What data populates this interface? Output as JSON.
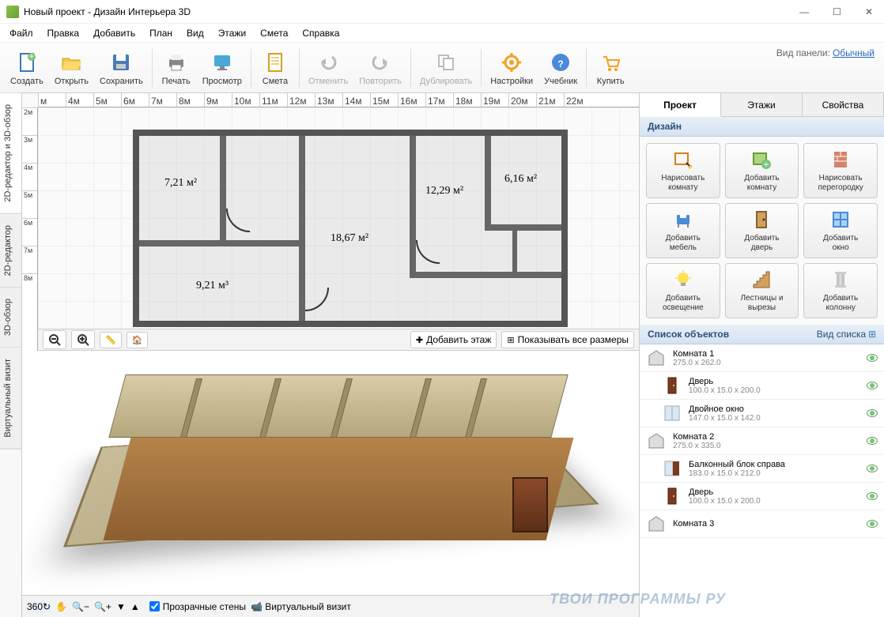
{
  "window": {
    "title": "Новый проект - Дизайн Интерьера 3D"
  },
  "menu": [
    "Файл",
    "Правка",
    "Добавить",
    "План",
    "Вид",
    "Этажи",
    "Смета",
    "Справка"
  ],
  "toolbar": [
    {
      "label": "Создать",
      "icon": "file-new"
    },
    {
      "label": "Открыть",
      "icon": "folder-open"
    },
    {
      "label": "Сохранить",
      "icon": "save"
    },
    {
      "sep": true
    },
    {
      "label": "Печать",
      "icon": "printer"
    },
    {
      "label": "Просмотр",
      "icon": "monitor"
    },
    {
      "sep": true
    },
    {
      "label": "Смета",
      "icon": "estimate"
    },
    {
      "sep": true
    },
    {
      "label": "Отменить",
      "icon": "undo",
      "disabled": true
    },
    {
      "label": "Повторить",
      "icon": "redo",
      "disabled": true
    },
    {
      "sep": true
    },
    {
      "label": "Дублировать",
      "icon": "duplicate",
      "disabled": true
    },
    {
      "sep": true
    },
    {
      "label": "Настройки",
      "icon": "gear"
    },
    {
      "label": "Учебник",
      "icon": "help"
    },
    {
      "sep": true
    },
    {
      "label": "Купить",
      "icon": "cart"
    }
  ],
  "panel_label": {
    "prefix": "Вид панели:",
    "link": "Обычный"
  },
  "left_tabs": [
    "2D-редактор и 3D-обзор",
    "2D-редактор",
    "3D-обзор",
    "Виртуальный визит"
  ],
  "ruler_h": [
    "м",
    "4м",
    "5м",
    "6м",
    "7м",
    "8м",
    "9м",
    "10м",
    "11м",
    "12м",
    "13м",
    "14м",
    "15м",
    "16м",
    "17м",
    "18м",
    "19м",
    "20м",
    "21м",
    "22м"
  ],
  "ruler_v": [
    "2м",
    "3м",
    "4м",
    "5м",
    "6м",
    "7м",
    "8м"
  ],
  "rooms": [
    {
      "label": "7,21 м²"
    },
    {
      "label": "18,67 м²"
    },
    {
      "label": "12,29 м²"
    },
    {
      "label": "6,16 м²"
    },
    {
      "label": "9,21 м³"
    }
  ],
  "floor_toolbar": {
    "add_floor": "Добавить этаж",
    "show_dims": "Показывать все размеры"
  },
  "bottom_toolbar": {
    "transparent": "Прозрачные стены",
    "camera": "Виртуальный визит"
  },
  "right_tabs": [
    "Проект",
    "Этажи",
    "Свойства"
  ],
  "design_header": "Дизайн",
  "design_buttons": [
    {
      "l1": "Нарисовать",
      "l2": "комнату",
      "icon": "draw-room"
    },
    {
      "l1": "Добавить",
      "l2": "комнату",
      "icon": "add-room"
    },
    {
      "l1": "Нарисовать",
      "l2": "перегородку",
      "icon": "partition"
    },
    {
      "l1": "Добавить",
      "l2": "мебель",
      "icon": "furniture"
    },
    {
      "l1": "Добавить",
      "l2": "дверь",
      "icon": "door"
    },
    {
      "l1": "Добавить",
      "l2": "окно",
      "icon": "window"
    },
    {
      "l1": "Добавить",
      "l2": "освещение",
      "icon": "light"
    },
    {
      "l1": "Лестницы и",
      "l2": "вырезы",
      "icon": "stairs"
    },
    {
      "l1": "Добавить",
      "l2": "колонну",
      "icon": "column"
    }
  ],
  "objects_header": "Список объектов",
  "list_view_label": "Вид списка",
  "objects": [
    {
      "name": "Комната 1",
      "dim": "275.0 x 262.0",
      "icon": "room",
      "indent": 0
    },
    {
      "name": "Дверь",
      "dim": "100.0 x 15.0 x 200.0",
      "icon": "door-i",
      "indent": 1
    },
    {
      "name": "Двойное окно",
      "dim": "147.0 x 15.0 x 142.0",
      "icon": "window-i",
      "indent": 1
    },
    {
      "name": "Комната 2",
      "dim": "275.0 x 335.0",
      "icon": "room",
      "indent": 0
    },
    {
      "name": "Балконный блок справа",
      "dim": "183.0 x 15.0 x 212.0",
      "icon": "balcony",
      "indent": 1
    },
    {
      "name": "Дверь",
      "dim": "100.0 x 15.0 x 200.0",
      "icon": "door-i",
      "indent": 1
    },
    {
      "name": "Комната 3",
      "dim": "",
      "icon": "room",
      "indent": 0
    }
  ],
  "watermark": "ТВОИ ПРОГРАММЫ РУ"
}
